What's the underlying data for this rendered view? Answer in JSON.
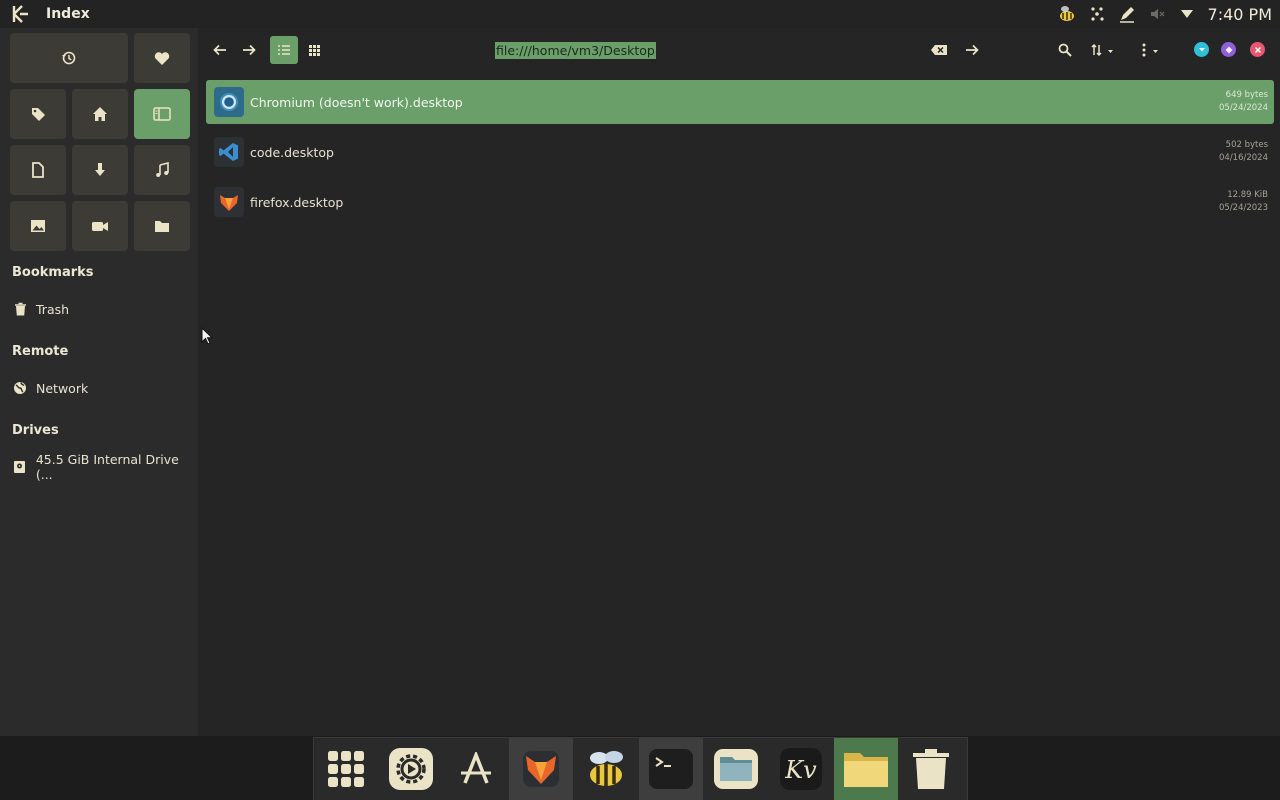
{
  "window": {
    "title": "Index"
  },
  "tray": {
    "clock": "7:40 PM"
  },
  "colors": {
    "accent": "#6a9f6a",
    "cream": "#ebe3c6",
    "bg": "#252525"
  },
  "sidebar": {
    "quick_places": [
      {
        "icon": "history-icon",
        "active": false
      },
      {
        "icon": "heart-icon",
        "active": false
      },
      {
        "icon": "tag-icon",
        "active": false
      },
      {
        "icon": "home-icon",
        "active": false
      },
      {
        "icon": "sidebar-panel-icon",
        "active": true
      },
      {
        "icon": "document-icon",
        "active": false
      },
      {
        "icon": "download-icon",
        "active": false
      },
      {
        "icon": "music-icon",
        "active": false
      },
      {
        "icon": "image-icon",
        "active": false
      },
      {
        "icon": "video-icon",
        "active": false
      },
      {
        "icon": "folder-icon",
        "active": false
      }
    ],
    "bookmarks_title": "Bookmarks",
    "bookmarks": [
      {
        "label": "Trash",
        "icon": "trash-icon"
      }
    ],
    "remote_title": "Remote",
    "remote": [
      {
        "label": "Network",
        "icon": "network-icon"
      }
    ],
    "drives_title": "Drives",
    "drives": [
      {
        "label": "45.5 GiB Internal Drive (...",
        "icon": "drive-icon"
      }
    ]
  },
  "toolbar": {
    "location": "file:///home/vm3/Desktop"
  },
  "files": [
    {
      "name": "Chromium (doesn't work).desktop",
      "size": "649 bytes",
      "date": "05/24/2024",
      "selected": true,
      "icon": "chromium-icon"
    },
    {
      "name": "code.desktop",
      "size": "502 bytes",
      "date": "04/16/2024",
      "selected": false,
      "icon": "vscode-icon"
    },
    {
      "name": "firefox.desktop",
      "size": "12.89 KiB",
      "date": "05/24/2023",
      "selected": false,
      "icon": "firefox-icon"
    }
  ],
  "dock": [
    {
      "icon": "app-grid-icon"
    },
    {
      "icon": "settings-icon"
    },
    {
      "icon": "appstore-icon"
    },
    {
      "icon": "firefox-icon"
    },
    {
      "icon": "bee-icon"
    },
    {
      "icon": "terminal-icon"
    },
    {
      "icon": "file-manager-icon"
    },
    {
      "icon": "kv-icon"
    },
    {
      "icon": "folder-icon"
    },
    {
      "icon": "trash-icon"
    }
  ]
}
